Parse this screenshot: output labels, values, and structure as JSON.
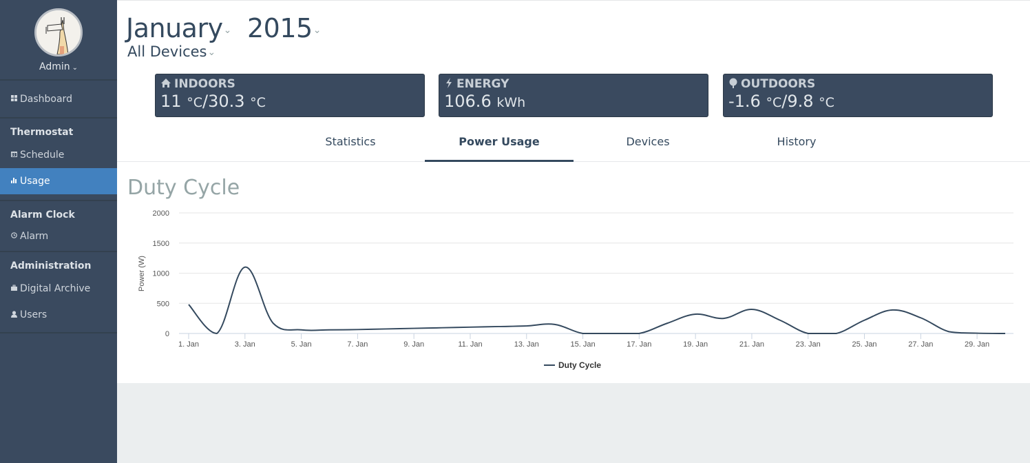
{
  "sidebar": {
    "user": "Admin",
    "dashboard": {
      "label": "Dashboard",
      "icon": "grid-icon"
    },
    "sections": [
      {
        "title": "Thermostat",
        "items": [
          {
            "label": "Schedule",
            "icon": "calendar-icon",
            "active": false
          },
          {
            "label": "Usage",
            "icon": "bar-chart-icon",
            "active": true
          }
        ]
      },
      {
        "title": "Alarm Clock",
        "items": [
          {
            "label": "Alarm",
            "icon": "clock-icon",
            "active": false
          }
        ]
      },
      {
        "title": "Administration",
        "items": [
          {
            "label": "Digital Archive",
            "icon": "briefcase-icon",
            "active": false
          },
          {
            "label": "Users",
            "icon": "user-icon",
            "active": false
          }
        ]
      }
    ]
  },
  "header": {
    "month": "January",
    "year": "2015",
    "device_filter": "All Devices"
  },
  "stats": [
    {
      "label": "INDOORS",
      "icon": "home-icon",
      "value1": "11",
      "unit1": "°C",
      "sep": "/",
      "value2": "30.3",
      "unit2": "°C"
    },
    {
      "label": "ENERGY",
      "icon": "lightning-icon",
      "value1": "106.6",
      "unit1": "kWh"
    },
    {
      "label": "OUTDOORS",
      "icon": "tree-icon",
      "value1": "-1.6",
      "unit1": "°C",
      "sep": "/",
      "value2": "9.8",
      "unit2": "°C"
    }
  ],
  "tabs": [
    {
      "label": "Statistics",
      "active": false
    },
    {
      "label": "Power Usage",
      "active": true
    },
    {
      "label": "Devices",
      "active": false
    },
    {
      "label": "History",
      "active": false
    }
  ],
  "colors": {
    "sidebar_bg": "#3a4a5f",
    "active_nav": "#4281bf",
    "series_line": "#34495e",
    "title_muted": "#95a5a6"
  },
  "chart_data": {
    "type": "line",
    "title": "Duty Cycle",
    "xlabel": "",
    "ylabel": "Power (W)",
    "ylim": [
      0,
      2000
    ],
    "yticks": [
      0,
      500,
      1000,
      1500,
      2000
    ],
    "x": [
      1,
      2,
      3,
      4,
      5,
      6,
      7,
      8,
      9,
      10,
      11,
      12,
      13,
      14,
      15,
      16,
      17,
      18,
      19,
      20,
      21,
      22,
      23,
      24,
      25,
      26,
      27,
      28,
      29,
      30
    ],
    "xtick_labels": [
      "1. Jan",
      "3. Jan",
      "5. Jan",
      "7. Jan",
      "9. Jan",
      "11. Jan",
      "13. Jan",
      "15. Jan",
      "17. Jan",
      "19. Jan",
      "21. Jan",
      "23. Jan",
      "25. Jan",
      "27. Jan",
      "29. Jan"
    ],
    "xticks": [
      1,
      3,
      5,
      7,
      9,
      11,
      13,
      15,
      17,
      19,
      21,
      23,
      25,
      27,
      29
    ],
    "grid": true,
    "legend": "bottom-center",
    "series": [
      {
        "name": "Duty Cycle",
        "color": "#34495e",
        "values": [
          480,
          0,
          1100,
          170,
          60,
          60,
          65,
          75,
          85,
          95,
          105,
          115,
          125,
          150,
          0,
          0,
          0,
          170,
          320,
          250,
          400,
          220,
          0,
          0,
          220,
          390,
          260,
          30,
          5,
          0
        ]
      }
    ]
  }
}
